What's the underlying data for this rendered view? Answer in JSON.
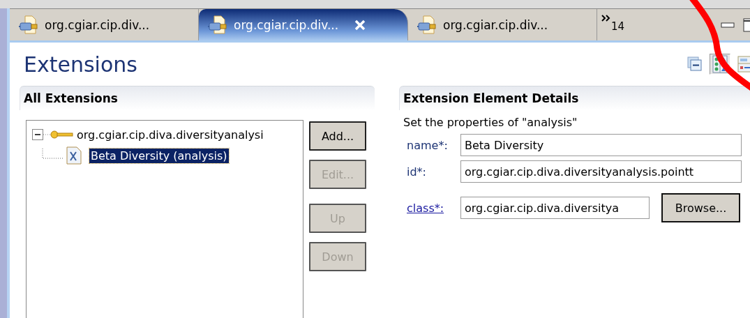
{
  "editor_tabs": [
    {
      "label": "org.cgiar.cip.div...",
      "selected": false
    },
    {
      "label": "org.cgiar.cip.div...",
      "selected": true
    },
    {
      "label": "org.cgiar.cip.div...",
      "selected": false
    }
  ],
  "overflow_count": "14",
  "page": {
    "title": "Extensions"
  },
  "toolbar": [
    {
      "kind": "collapse",
      "selected": false
    },
    {
      "kind": "horizontal",
      "selected": true
    },
    {
      "kind": "vertical",
      "selected": false
    }
  ],
  "all_extensions": {
    "title": "All Extensions",
    "tree": [
      {
        "label": "org.cgiar.cip.diva.diversityanalysi",
        "expanded": true,
        "children": [
          {
            "label": "Beta Diversity (analysis)",
            "selected": true
          }
        ]
      }
    ],
    "buttons": [
      {
        "label": "Add...",
        "disabled": false
      },
      {
        "label": "Edit...",
        "disabled": true
      },
      {
        "label": "Up",
        "disabled": true
      },
      {
        "label": "Down",
        "disabled": true
      }
    ]
  },
  "details": {
    "title": "Extension Element Details",
    "description": "Set the properties of \"analysis\"",
    "fields": [
      {
        "label": "name*:",
        "value": "Beta Diversity",
        "link": false
      },
      {
        "label": "id*:",
        "value": "org.cgiar.cip.diva.diversityanalysis.pointt",
        "link": false
      },
      {
        "label": "class*:",
        "value": "org.cgiar.cip.diva.diversitya",
        "link": true,
        "button": "Browse..."
      }
    ]
  }
}
